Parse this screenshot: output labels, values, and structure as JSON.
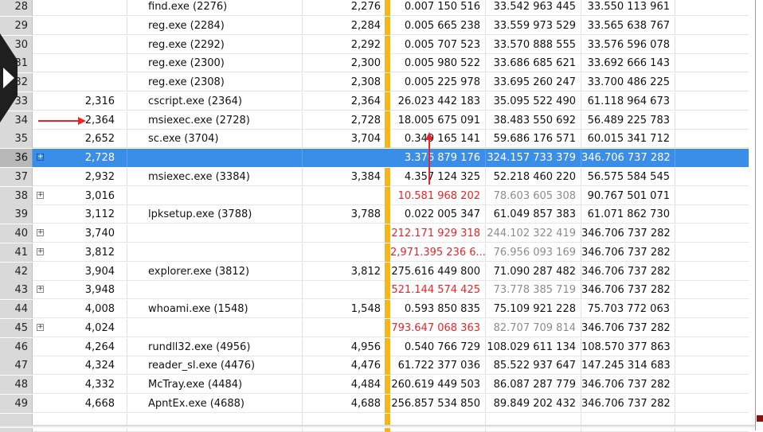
{
  "colors": {
    "selection": "#3b8ee8",
    "bar": "#f7b51c",
    "red_text": "#e8262a",
    "gray_text": "#8c8c8c",
    "arrow": "#e8262a"
  },
  "rows": [
    {
      "num": "28",
      "expander": "",
      "pid": "",
      "name": "find.exe (2276)",
      "pid2": "2,276",
      "v1": "0.007 150 516",
      "v2": "33.542 963 445",
      "v3": "33.550 113 961",
      "v1_style": "",
      "v2_style": ""
    },
    {
      "num": "29",
      "expander": "",
      "pid": "",
      "name": "reg.exe (2284)",
      "pid2": "2,284",
      "v1": "0.005 665 238",
      "v2": "33.559 973 529",
      "v3": "33.565 638 767",
      "v1_style": "",
      "v2_style": ""
    },
    {
      "num": "30",
      "expander": "",
      "pid": "",
      "name": "reg.exe (2292)",
      "pid2": "2,292",
      "v1": "0.005 707 523",
      "v2": "33.570 888 555",
      "v3": "33.576 596 078",
      "v1_style": "",
      "v2_style": ""
    },
    {
      "num": "31",
      "expander": "",
      "pid": "",
      "name": "reg.exe (2300)",
      "pid2": "2,300",
      "v1": "0.005 980 522",
      "v2": "33.686 685 621",
      "v3": "33.692 666 143",
      "v1_style": "",
      "v2_style": ""
    },
    {
      "num": "32",
      "expander": "",
      "pid": "",
      "name": "reg.exe (2308)",
      "pid2": "2,308",
      "v1": "0.005 225 978",
      "v2": "33.695 260 247",
      "v3": "33.700 486 225",
      "v1_style": "",
      "v2_style": ""
    },
    {
      "num": "33",
      "expander": "",
      "pid": "2,316",
      "name": "cscript.exe (2364)",
      "pid2": "2,364",
      "v1": "26.023 442 183",
      "v2": "35.095 522 490",
      "v3": "61.118 964 673",
      "v1_style": "",
      "v2_style": ""
    },
    {
      "num": "34",
      "expander": "",
      "pid": "2,364",
      "name": "msiexec.exe (2728)",
      "pid2": "2,728",
      "v1": "18.005 675 091",
      "v2": "38.483 550 692",
      "v3": "56.489 225 783",
      "v1_style": "",
      "v2_style": ""
    },
    {
      "num": "35",
      "expander": "",
      "pid": "2,652",
      "name": "sc.exe (3704)",
      "pid2": "3,704",
      "v1": "0.349 165 141",
      "v2": "59.686 176 571",
      "v3": "60.015 341 712",
      "v1_style": "",
      "v2_style": ""
    },
    {
      "num": "36",
      "expander": "+",
      "pid": "2,728",
      "name": "",
      "pid2": "",
      "v1": "3.376 879 176",
      "v2": "324.157 733 379",
      "v3": "346.706 737 282",
      "v1_style": "",
      "v2_style": "",
      "selected": true
    },
    {
      "num": "37",
      "expander": "",
      "pid": "2,932",
      "name": "msiexec.exe (3384)",
      "pid2": "3,384",
      "v1": "4.357 124 325",
      "v2": "52.218 460 220",
      "v3": "56.575 584 545",
      "v1_style": "",
      "v2_style": ""
    },
    {
      "num": "38",
      "expander": "+",
      "pid": "3,016",
      "name": "",
      "pid2": "",
      "v1": "10.581 968 202",
      "v2": "78.603 605 308",
      "v3": "90.767 501 071",
      "v1_style": "red",
      "v2_style": "gray"
    },
    {
      "num": "39",
      "expander": "",
      "pid": "3,112",
      "name": "lpksetup.exe (3788)",
      "pid2": "3,788",
      "v1": "0.022 005 347",
      "v2": "61.049 857 383",
      "v3": "61.071 862 730",
      "v1_style": "",
      "v2_style": ""
    },
    {
      "num": "40",
      "expander": "+",
      "pid": "3,740",
      "name": "",
      "pid2": "",
      "v1": "212.171 929 318",
      "v2": "244.102 322 419",
      "v3": "346.706 737 282",
      "v1_style": "red",
      "v2_style": "gray"
    },
    {
      "num": "41",
      "expander": "+",
      "pid": "3,812",
      "name": "",
      "pid2": "",
      "v1": "2,971.395 236 6...",
      "v2": "76.956 093 169",
      "v3": "346.706 737 282",
      "v1_style": "red",
      "v2_style": "gray"
    },
    {
      "num": "42",
      "expander": "",
      "pid": "3,904",
      "name": "explorer.exe (3812)",
      "pid2": "3,812",
      "v1": "275.616 449 800",
      "v2": "71.090 287 482",
      "v3": "346.706 737 282",
      "v1_style": "",
      "v2_style": ""
    },
    {
      "num": "43",
      "expander": "+",
      "pid": "3,948",
      "name": "",
      "pid2": "",
      "v1": "521.144 574 425",
      "v2": "73.778 385 719",
      "v3": "346.706 737 282",
      "v1_style": "red",
      "v2_style": "gray"
    },
    {
      "num": "44",
      "expander": "",
      "pid": "4,008",
      "name": "whoami.exe (1548)",
      "pid2": "1,548",
      "v1": "0.593 850 835",
      "v2": "75.109 921 228",
      "v3": "75.703 772 063",
      "v1_style": "",
      "v2_style": ""
    },
    {
      "num": "45",
      "expander": "+",
      "pid": "4,024",
      "name": "",
      "pid2": "",
      "v1": "793.647 068 363",
      "v2": "82.707 709 814",
      "v3": "346.706 737 282",
      "v1_style": "red",
      "v2_style": "gray"
    },
    {
      "num": "46",
      "expander": "",
      "pid": "4,264",
      "name": "rundll32.exe (4956)",
      "pid2": "4,956",
      "v1": "0.540 766 729",
      "v2": "108.029 611 134",
      "v3": "108.570 377 863",
      "v1_style": "",
      "v2_style": ""
    },
    {
      "num": "47",
      "expander": "",
      "pid": "4,324",
      "name": "reader_sl.exe (4476)",
      "pid2": "4,476",
      "v1": "61.722 377 036",
      "v2": "85.522 937 647",
      "v3": "147.245 314 683",
      "v1_style": "",
      "v2_style": ""
    },
    {
      "num": "48",
      "expander": "",
      "pid": "4,332",
      "name": "McTray.exe (4484)",
      "pid2": "4,484",
      "v1": "260.619 449 503",
      "v2": "86.087 287 779",
      "v3": "346.706 737 282",
      "v1_style": "",
      "v2_style": ""
    },
    {
      "num": "49",
      "expander": "",
      "pid": "4,668",
      "name": "ApntEx.exe (4688)",
      "pid2": "4,688",
      "v1": "256.857 534 850",
      "v2": "89.849 202 432",
      "v3": "346.706 737 282",
      "v1_style": "",
      "v2_style": ""
    },
    {
      "num": "",
      "expander": "",
      "pid": "",
      "name": "",
      "pid2": "",
      "v1": "",
      "v2": "",
      "v3": "",
      "v1_style": "",
      "v2_style": ""
    }
  ]
}
